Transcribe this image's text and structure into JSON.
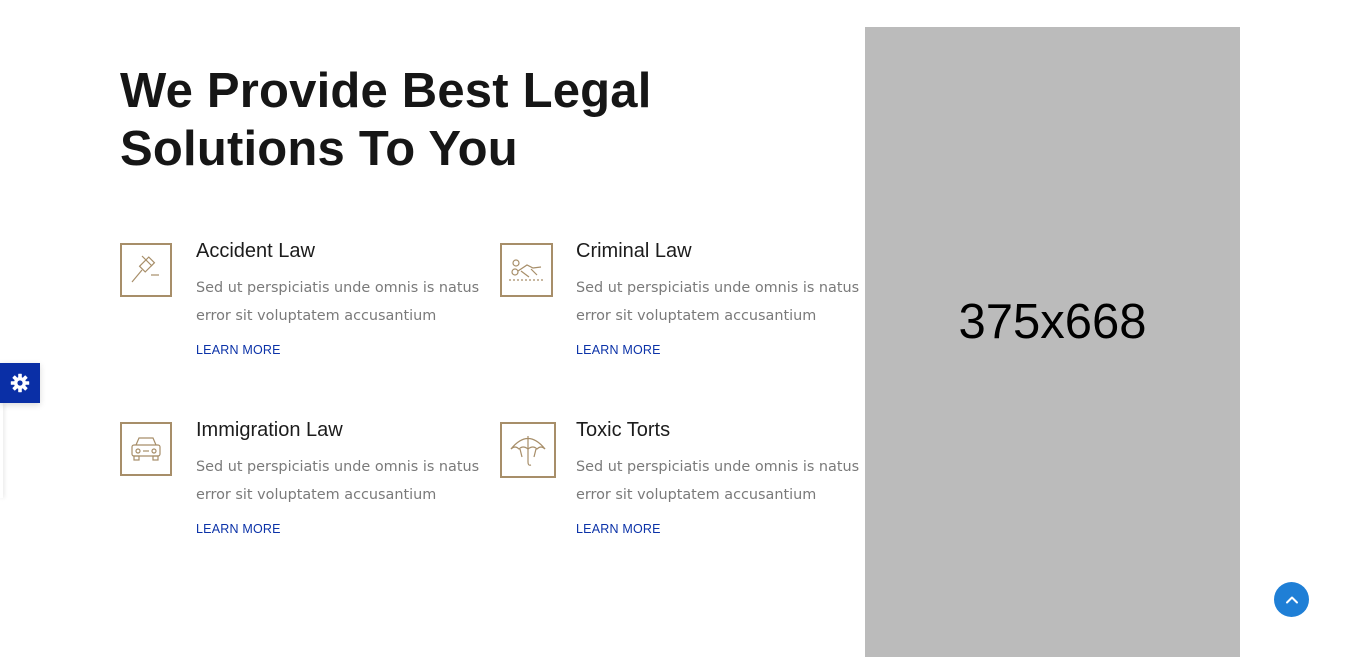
{
  "section": {
    "title_line1": "We Provide Best Legal",
    "title_line2": "Solutions To You"
  },
  "services": [
    {
      "title": "Accident Law",
      "description": "Sed ut perspiciatis unde omnis is natus error sit voluptatem accusantium",
      "link": "LEARN MORE",
      "icon": "gavel-icon"
    },
    {
      "title": "Criminal Law",
      "description": "Sed ut perspiciatis unde omnis is natus error sit voluptatem accusantium",
      "link": "LEARN MORE",
      "icon": "handcuffs-icon"
    },
    {
      "title": "Immigration Law",
      "description": "Sed ut perspiciatis unde omnis is natus error sit voluptatem accusantium",
      "link": "LEARN MORE",
      "icon": "car-icon"
    },
    {
      "title": "Toxic Torts",
      "description": "Sed ut perspiciatis unde omnis is natus error sit voluptatem accusantium",
      "link": "LEARN MORE",
      "icon": "umbrella-icon"
    }
  ],
  "image_placeholder": {
    "label": "375x668"
  },
  "widgets": {
    "settings_icon": "gear-icon",
    "scroll_top_icon": "chevron-up-icon"
  },
  "colors": {
    "accent_gold": "#a78e69",
    "link_blue": "#0b32a8",
    "settings_blue": "#0a2fa6",
    "scroll_blue": "#1f7fd6",
    "placeholder_gray": "#bbbbbb"
  }
}
